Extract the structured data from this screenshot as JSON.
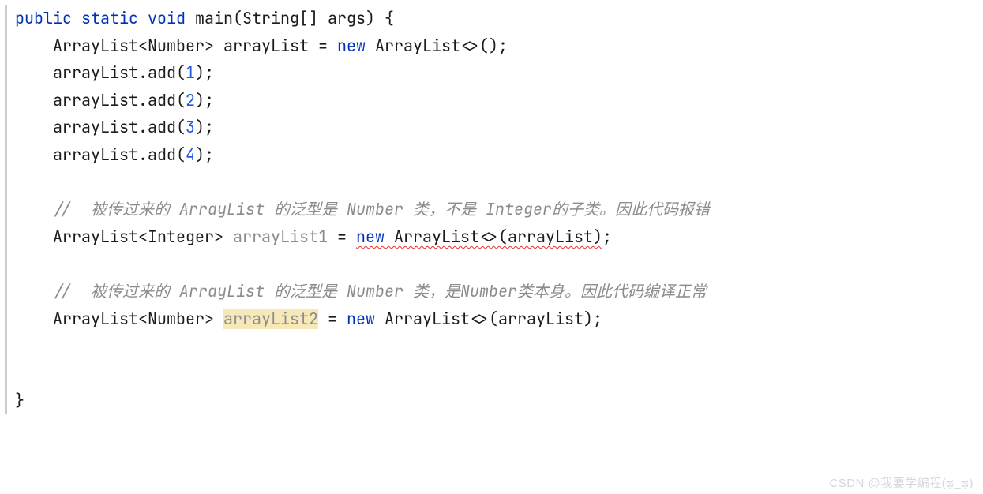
{
  "code": {
    "sig": {
      "kw_public": "public",
      "kw_static": "static",
      "kw_void": "void",
      "name": "main",
      "params_open": "(",
      "param_type": "String[]",
      "param_name": "args",
      "params_close_brace": ") {"
    },
    "decl1": {
      "indent": "    ",
      "type": "ArrayList<Number>",
      "space": " ",
      "var": "arrayList",
      "eq": " = ",
      "kw_new": "new",
      "ctor": " ArrayList<>();"
    },
    "add1": {
      "indent": "    ",
      "call_pre": "arrayList.add(",
      "num": "1",
      "call_post": ");"
    },
    "add2": {
      "indent": "    ",
      "call_pre": "arrayList.add(",
      "num": "2",
      "call_post": ");"
    },
    "add3": {
      "indent": "    ",
      "call_pre": "arrayList.add(",
      "num": "3",
      "call_post": ");"
    },
    "add4": {
      "indent": "    ",
      "call_pre": "arrayList.add(",
      "num": "4",
      "call_post": ");"
    },
    "blank": "",
    "comment1": {
      "indent": "    ",
      "text": "//  被传过来的 ArrayList 的泛型是 Number 类，不是 Integer的子类。因此代码报错"
    },
    "decl2": {
      "indent": "    ",
      "type": "ArrayList<Integer>",
      "space": " ",
      "var": "arrayList1",
      "eq": " = ",
      "kw_new": "new",
      "ctor_a": " ArrayList<>(arrayList)",
      "semi": ";"
    },
    "comment2": {
      "indent": "    ",
      "text": "//  被传过来的 ArrayList 的泛型是 Number 类，是Number类本身。因此代码编译正常"
    },
    "decl3": {
      "indent": "    ",
      "type": "ArrayList<Number>",
      "space": " ",
      "var": "arrayList2",
      "eq": " = ",
      "kw_new": "new",
      "ctor": " ArrayList<>(arrayList);"
    },
    "close": "}"
  },
  "watermark": "CSDN @我要学编程(ಥ_ಥ)"
}
